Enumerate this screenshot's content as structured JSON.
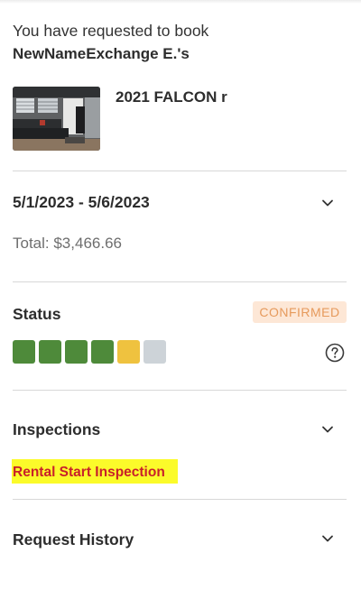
{
  "booking": {
    "intro_text": "You have requested to book",
    "host_name": "NewNameExchange E.'s"
  },
  "listing": {
    "title": "2021 FALCON r",
    "thumbnail_icon": "rv-interior-photo"
  },
  "dates": {
    "range": "5/1/2023 - 5/6/2023",
    "total": "Total: $3,466.66"
  },
  "status": {
    "label": "Status",
    "badge": "CONFIRMED",
    "badge_bg": "#fde7d6",
    "badge_color": "#e69a5c",
    "progress_steps": [
      "complete",
      "complete",
      "complete",
      "complete",
      "current",
      "pending"
    ],
    "step_colors": {
      "complete": "#4e8a3a",
      "current": "#efc23f",
      "pending": "#cdd3d8"
    },
    "help_icon": "question-circle-icon"
  },
  "inspections": {
    "label": "Inspections",
    "link_text": "Rental Start Inspection",
    "highlight_color": "#fbfb2a",
    "link_color": "#c8202a"
  },
  "request_history": {
    "label": "Request History"
  }
}
